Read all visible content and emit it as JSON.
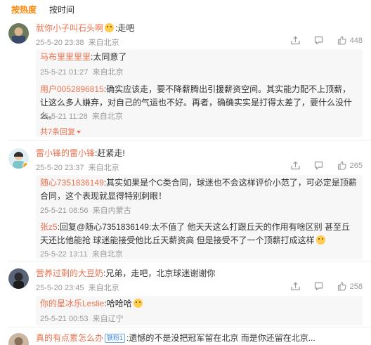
{
  "tabs": {
    "hot": "按热度",
    "time": "按时间"
  },
  "comments": [
    {
      "user": "就你小子叫石头啊",
      "text": ":走吧",
      "date": "25-5-20 23:38",
      "location": "来自北京",
      "likes": "448",
      "replies": [
        {
          "user": "马布里里里里",
          "text": ":太同意了",
          "date": "25-5-21 01:27",
          "location": "来自北京"
        },
        {
          "user": "用户0052896815",
          "text": ":确实应该走，要不降薪腾出引援薪资空间。其实能力配不上顶薪，让这么多人嫌弃，对自己的气运也不好。再者，确确实实是打得太差了，要什么没什么。",
          "date": "25-5-21 11:28",
          "location": "来自北京"
        }
      ],
      "more": "共7条回复"
    },
    {
      "user": "雷小锋的雷小锋",
      "text": ":赶紧走!",
      "date": "25-5-20 23:37",
      "location": "来自北京",
      "likes": "265",
      "replies": [
        {
          "user": "随心7351836149",
          "text": ":其实如果是个C类合同，球迷也不会这样评价小范了，可必定是顶薪合同，这个表现就显得特别刺眼！",
          "date": "25-5-21 08:56",
          "location": "来自内蒙古"
        },
        {
          "user": "张z5",
          "text": ":回复@随心7351836149:太不值了 他天天这么打跟丘天的作用有啥区别  甚至丘天还比他能抢 球迷能接受他比丘天薪资高 但是接受不了一个顶薪打成这样",
          "date": "25-5-22 13:11",
          "location": "来自北京"
        }
      ]
    },
    {
      "user": "营养过剩的大豆奶",
      "text": ":兄弟，走吧，北京球迷谢谢你",
      "date": "25-5-20 23:45",
      "location": "来自北京",
      "likes": "258",
      "replies": [
        {
          "user": "你的星冰乐Leslie",
          "text": ":哈哈哈",
          "date": "25-5-21 00:53",
          "location": "来自辽宁"
        }
      ]
    },
    {
      "user": "真的有点累怎么办",
      "badge": "铁粉1",
      "text": ":遗憾的不是没把冠军留在北京 而是你还留在北京..."
    }
  ],
  "colors": {
    "accent": "#ff8200",
    "username": "#eb7350",
    "meta": "#999999",
    "reply_bg": "#f7f7f7"
  },
  "icons": [
    "share-icon",
    "comment-icon",
    "like-icon"
  ]
}
